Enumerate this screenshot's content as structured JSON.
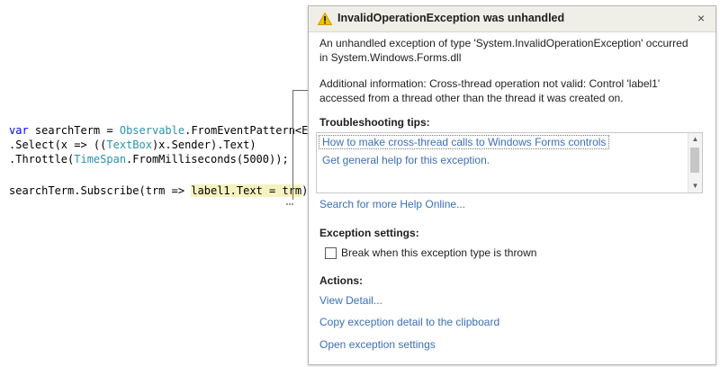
{
  "code": {
    "line1": {
      "kw": "var",
      "ident": " searchTerm = ",
      "type": "Observable",
      "rest": ".FromEventPattern<Eve"
    },
    "line2": {
      "pre": ".Select(x => ((",
      "type": "TextBox",
      "post": ")x.Sender).Text)"
    },
    "line3": {
      "pre": ".Throttle(",
      "type": "TimeSpan",
      "post": ".FromMilliseconds(5000));"
    },
    "line4": {
      "pre": "searchTerm.Subscribe(trm => ",
      "highlight": "label1.Text = trm",
      "post": ");"
    }
  },
  "popup": {
    "title": "InvalidOperationException was unhandled",
    "close": "×",
    "description": "An unhandled exception of type 'System.InvalidOperationException' occurred in System.Windows.Forms.dll",
    "additional_info": "Additional information: Cross-thread operation not valid: Control 'label1' accessed from a thread other than the thread it was created on.",
    "tips_heading": "Troubleshooting tips:",
    "tips": [
      "How to make cross-thread calls to Windows Forms controls",
      "Get general help for this exception."
    ],
    "search_link": "Search for more Help Online...",
    "settings_heading": "Exception settings:",
    "break_checkbox_label": "Break when this exception type is thrown",
    "break_checked": false,
    "actions_heading": "Actions:",
    "actions": [
      "View Detail...",
      "Copy exception detail to the clipboard",
      "Open exception settings"
    ],
    "scroll_up": "▲",
    "scroll_down": "▼"
  },
  "colors": {
    "keyword": "#0000ff",
    "type": "#2b91af",
    "highlight": "#f6f2bf",
    "link": "#3b6fb6",
    "warning": "#f2c200"
  }
}
